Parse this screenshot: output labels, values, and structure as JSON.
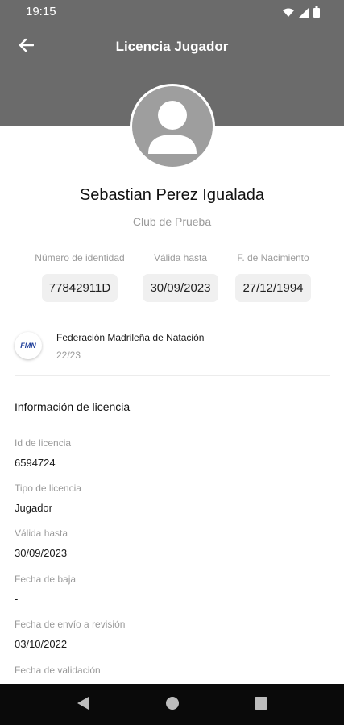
{
  "status_bar": {
    "time": "19:15"
  },
  "app_bar": {
    "title": "Licencia Jugador"
  },
  "profile": {
    "name": "Sebastian Perez Igualada",
    "club": "Club de Prueba"
  },
  "id_fields": [
    {
      "label": "Número de identidad",
      "value": "77842911D"
    },
    {
      "label": "Válida hasta",
      "value": "30/09/2023"
    },
    {
      "label": "F. de Nacimiento",
      "value": "27/12/1994"
    }
  ],
  "federation": {
    "logo_text": "FMN",
    "name": "Federación Madrileña de Natación",
    "season": "22/23"
  },
  "license_info": {
    "title": "Información de licencia",
    "fields": [
      {
        "label": "Id de licencia",
        "value": "6594724"
      },
      {
        "label": "Tipo de licencia",
        "value": "Jugador"
      },
      {
        "label": "Válida hasta",
        "value": "30/09/2023"
      },
      {
        "label": "Fecha de baja",
        "value": "-"
      },
      {
        "label": "Fecha de envío a revisión",
        "value": "03/10/2022"
      },
      {
        "label": "Fecha de validación",
        "value": ""
      }
    ]
  },
  "colors": {
    "header": "#6b6b6b",
    "navbar": "#0a0a0a",
    "muted_text": "#9a9a9a",
    "chip": "#f0f0f0"
  },
  "icons": {
    "back": "arrow-left-icon",
    "wifi": "wifi-icon",
    "signal": "signal-icon",
    "battery": "battery-icon",
    "nav_back": "triangle-back-icon",
    "nav_home": "circle-home-icon",
    "nav_recents": "square-recents-icon"
  }
}
